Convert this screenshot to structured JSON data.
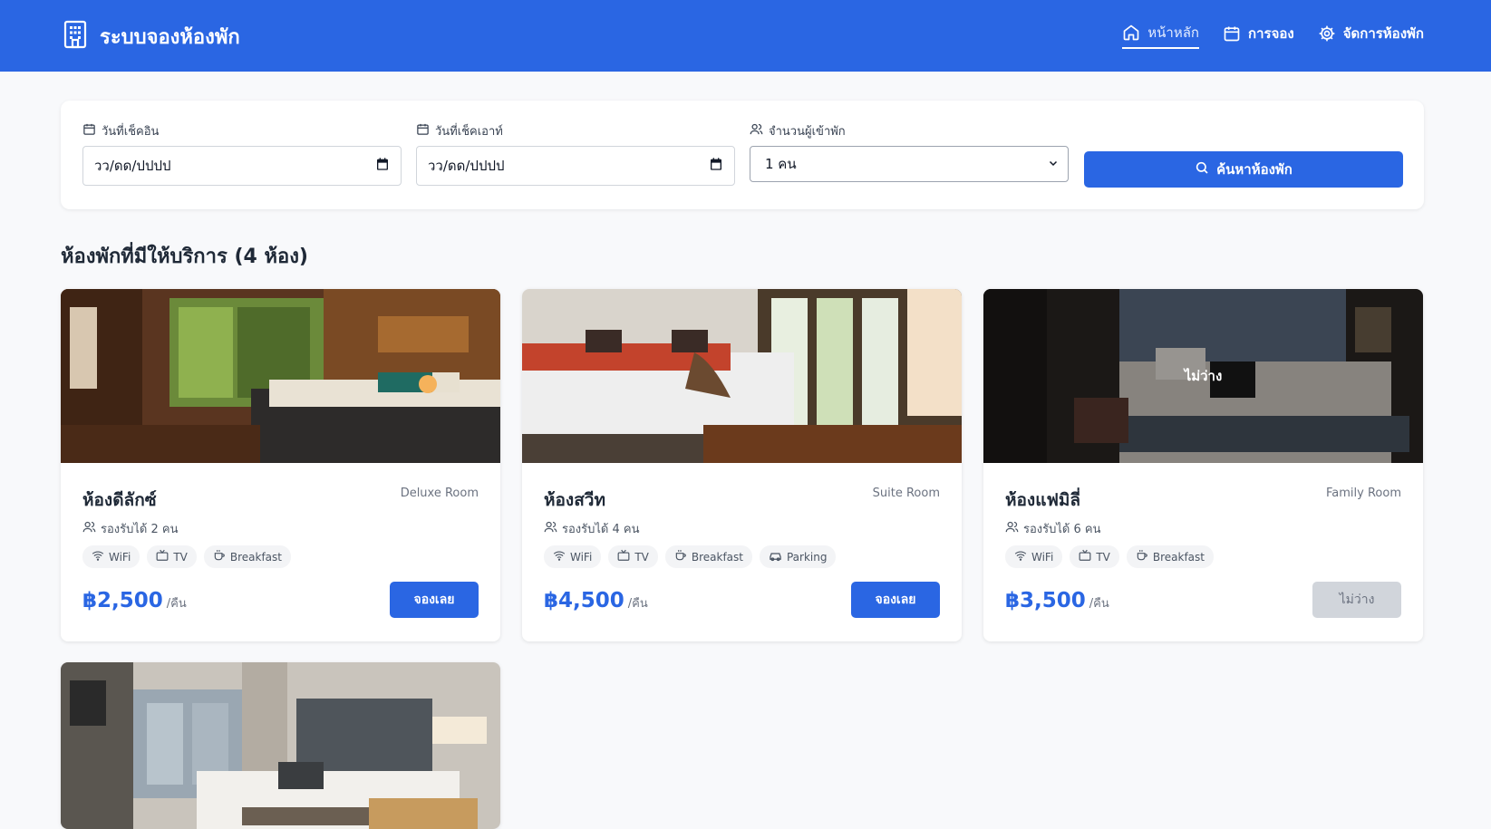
{
  "header": {
    "title": "ระบบจองห้องพัก",
    "nav": [
      {
        "label": "หน้าหลัก",
        "icon": "home-icon",
        "active": true
      },
      {
        "label": "การจอง",
        "icon": "calendar-icon",
        "active": false
      },
      {
        "label": "จัดการห้องพัก",
        "icon": "gear-icon",
        "active": false
      }
    ]
  },
  "search": {
    "checkin_label": "วันที่เช็คอิน",
    "checkin_value": "วว/ดด/ปปปป",
    "checkout_label": "วันที่เช็คเอาท์",
    "checkout_value": "วว/ดด/ปปปป",
    "guests_label": "จำนวนผู้เข้าพัก",
    "guests_value": "1 คน",
    "button_label": "ค้นหาห้องพัก"
  },
  "section_title": "ห้องพักที่มีให้บริการ (4 ห้อง)",
  "rooms": [
    {
      "name": "ห้องดีลักซ์",
      "type": "Deluxe Room",
      "capacity": "รองรับได้ 2 คน",
      "amenities": [
        "WiFi",
        "TV",
        "Breakfast"
      ],
      "price": "฿2,500",
      "unit": "/คืน",
      "button": "จองเลย",
      "available": true
    },
    {
      "name": "ห้องสวีท",
      "type": "Suite Room",
      "capacity": "รองรับได้ 4 คน",
      "amenities": [
        "WiFi",
        "TV",
        "Breakfast",
        "Parking"
      ],
      "price": "฿4,500",
      "unit": "/คืน",
      "button": "จองเลย",
      "available": true
    },
    {
      "name": "ห้องแฟมิลี่",
      "type": "Family Room",
      "capacity": "รองรับได้ 6 คน",
      "amenities": [
        "WiFi",
        "TV",
        "Breakfast"
      ],
      "price": "฿3,500",
      "unit": "/คืน",
      "button": "ไม่ว่าง",
      "available": false,
      "overlay": "ไม่ว่าง"
    }
  ],
  "colors": {
    "primary": "#2a66e3",
    "background": "#f8f9fb"
  }
}
